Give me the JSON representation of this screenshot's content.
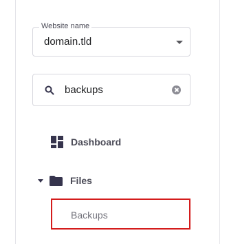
{
  "website_select": {
    "legend": "Website name",
    "value": "domain.tld"
  },
  "search": {
    "value": "backups"
  },
  "nav": {
    "dashboard": "Dashboard",
    "files": "Files",
    "backups": "Backups"
  }
}
